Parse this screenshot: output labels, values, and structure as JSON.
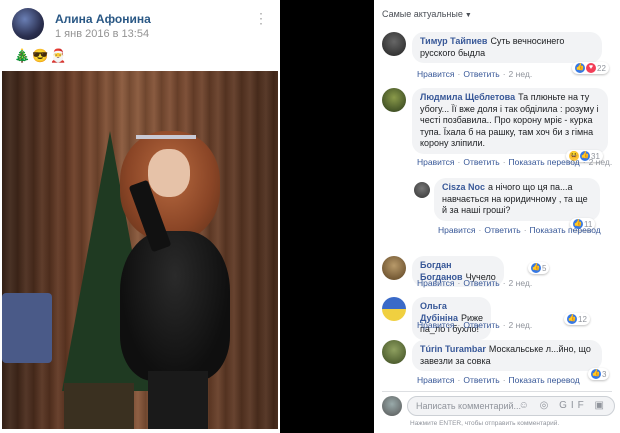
{
  "post": {
    "author": "Алина Афонина",
    "date": "1 янв 2016 в 13:54",
    "more_icon": "⋮",
    "emojis": "🎄😎🎅"
  },
  "comments_panel": {
    "sort_label": "Самые актуальные",
    "comments": [
      {
        "name": "Тимур Тайпиев",
        "text": "Суть вечносинего русского быдла",
        "like": "Нравится",
        "reply": "Ответить",
        "translate": "",
        "time": "2 нед.",
        "reactions": "22"
      },
      {
        "name": "Людмила Щеблетова",
        "text": "Та плюньте на ту убогу... Її вже доля і так обділила : розуму і честі позбавила.. Про корону мріє - курка тупа. Їхала б на рашку, там хоч би з гімна корону зліпили.",
        "like": "Нравится",
        "reply": "Ответить",
        "translate": "Показать перевод",
        "time": "2 нед.",
        "reactions": "31"
      },
      {
        "name": "Cisza Noc",
        "text": "а нічого що ця па...а навчається на юридичному , та ще й за наші гроші?",
        "like": "Нравится",
        "reply": "Ответить",
        "translate": "Показать перевод",
        "time": "",
        "reactions": "11"
      },
      {
        "name": "Богдан Богданов",
        "text": "Чучело",
        "like": "Нравится",
        "reply": "Ответить",
        "translate": "",
        "time": "2 нед.",
        "reactions": "5"
      },
      {
        "name": "Ольга Дубініна",
        "text": "Риже па_ло і бухло!",
        "like": "Нравится",
        "reply": "Ответить",
        "translate": "",
        "time": "2 нед.",
        "reactions": "12"
      },
      {
        "name": "Túrin Turambar",
        "text": "Москальське л...йно, що завезли за совка",
        "like": "Нравится",
        "reply": "Ответить",
        "translate": "Показать перевод",
        "time": "",
        "reactions": "3"
      }
    ],
    "write_placeholder": "Написать комментарий...",
    "write_icons": "☺ ◎ GIF ▣",
    "hint": "Нажмите ENTER, чтобы отправить комментарий."
  },
  "colors": {
    "link": "#385898",
    "bubble": "#f2f3f5",
    "like_reaction": "#3578e5",
    "love_reaction": "#f33e58"
  }
}
